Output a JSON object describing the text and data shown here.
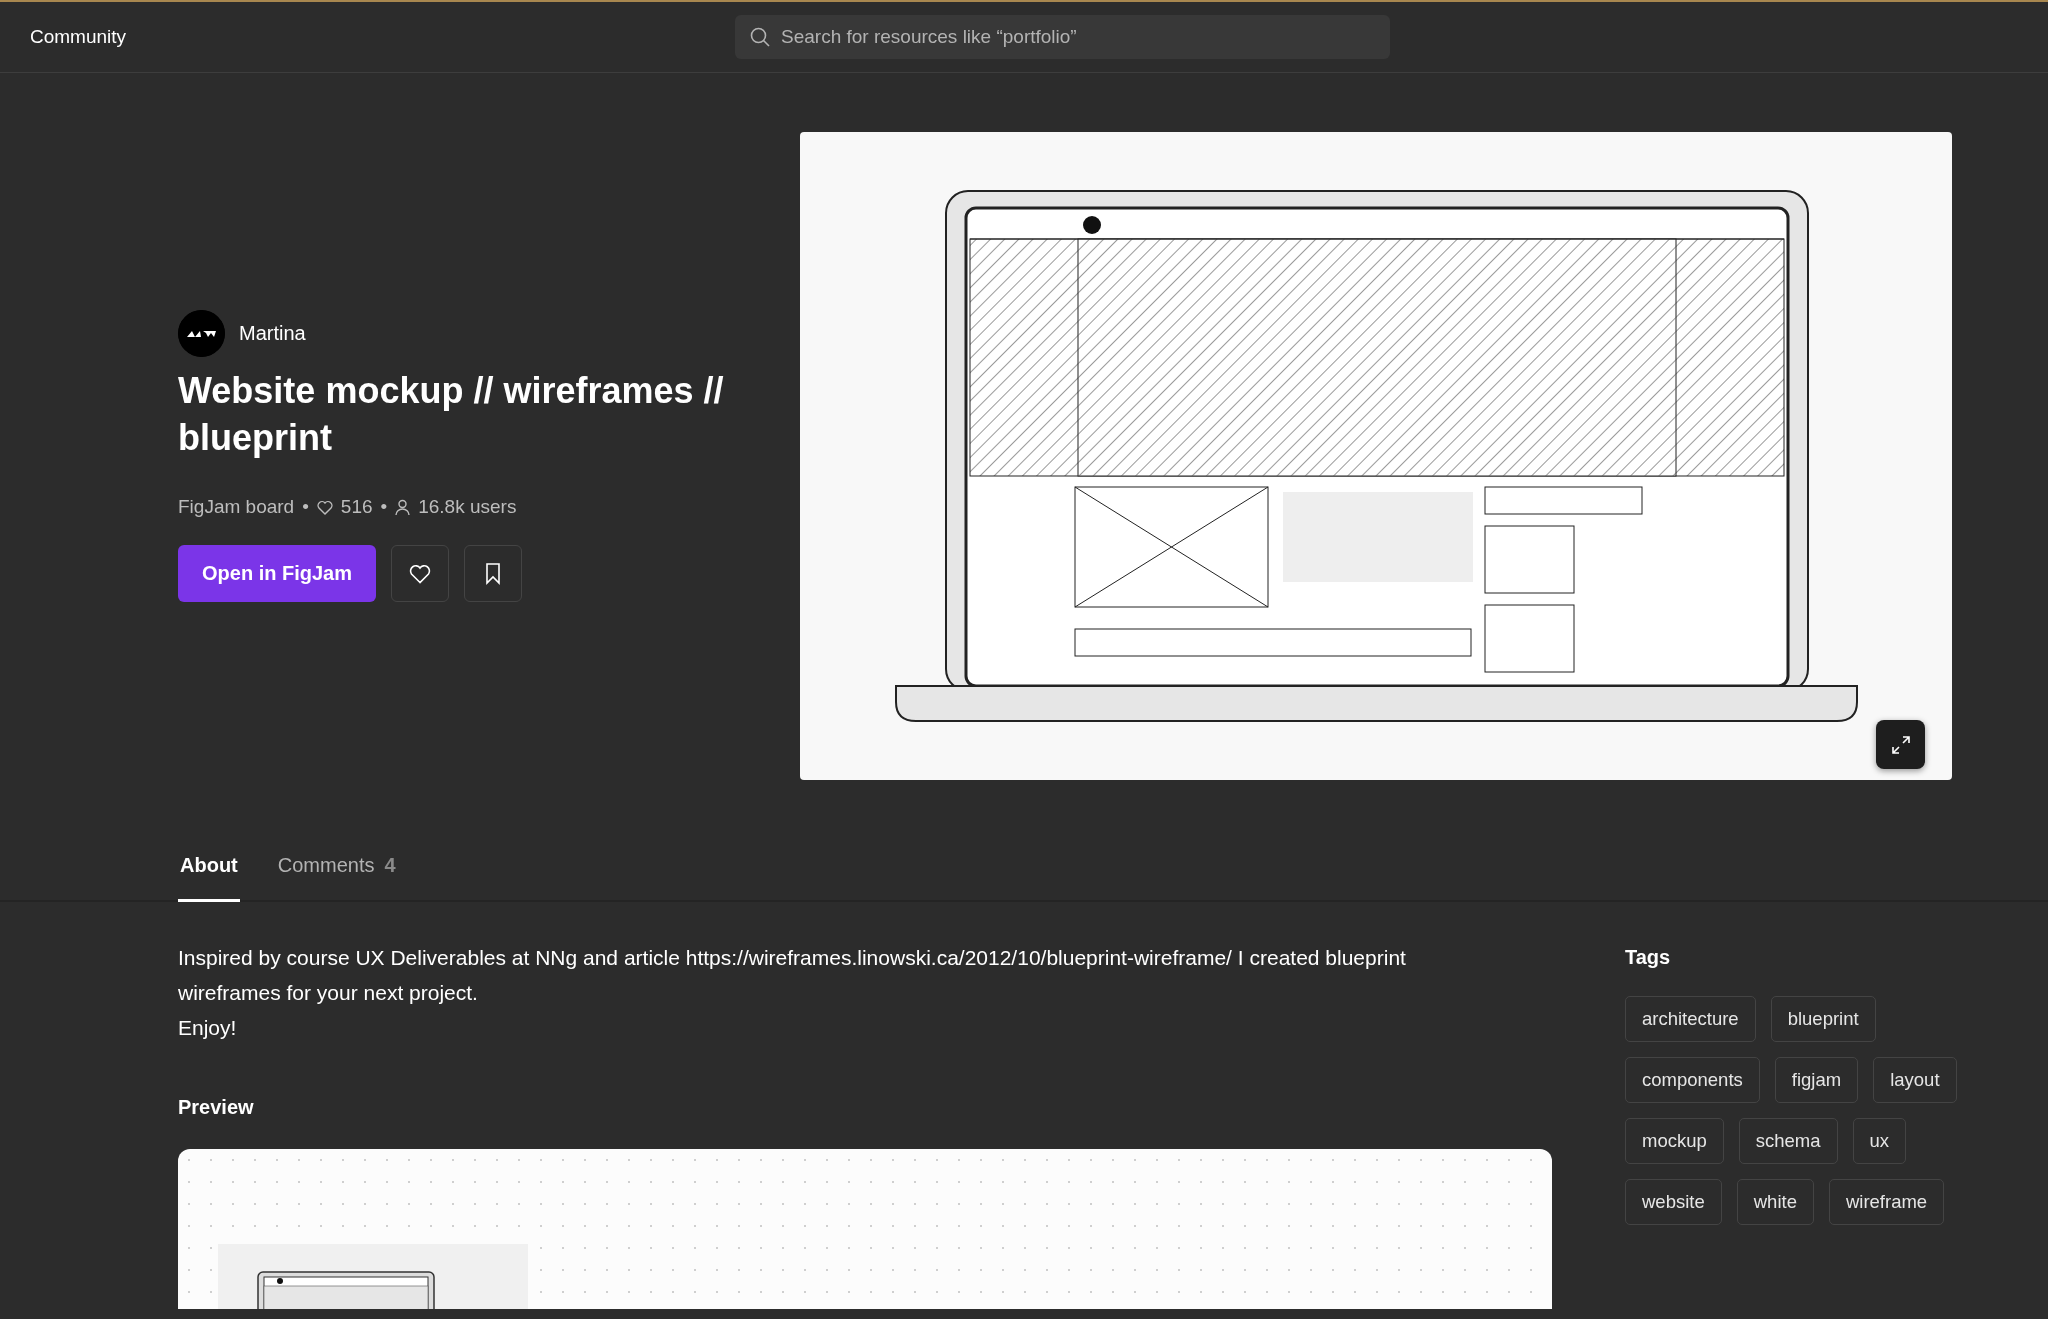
{
  "top_bar": {
    "title": "Community",
    "search": {
      "placeholder": "Search for resources like “portfolio”"
    }
  },
  "resource": {
    "author": "Martina",
    "title": "Website mockup // wireframes // blueprint",
    "type": "FigJam board",
    "separator": "•",
    "likes": "516",
    "users": "16.8k users",
    "primary_button": "Open in FigJam"
  },
  "tabs": [
    {
      "label": "About",
      "selected": true
    },
    {
      "label": "Comments",
      "count": "4",
      "selected": false
    }
  ],
  "description": [
    "Inspired by course UX Deliverables at NNg and article https://wireframes.linowski.ca/2012/10/blueprint-wireframe/ I created blueprint wireframes for your next project.",
    "Enjoy!"
  ],
  "preview": {
    "heading": "Preview"
  },
  "tags": {
    "heading": "Tags",
    "items": [
      "architecture",
      "blueprint",
      "components",
      "figjam",
      "layout",
      "mockup",
      "schema",
      "ux",
      "website",
      "white",
      "wireframe"
    ]
  }
}
